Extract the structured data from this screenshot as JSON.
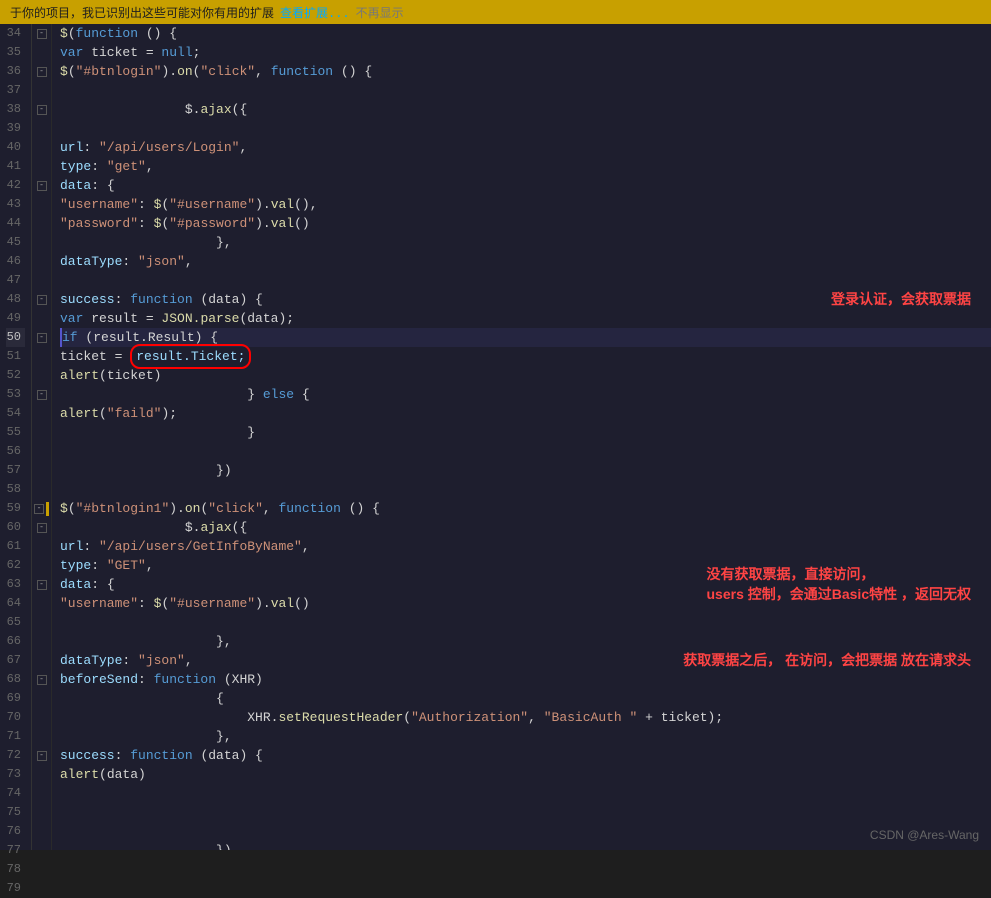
{
  "banner": {
    "text": "于你的项目，我已识别出这些可能对你有用的扩展",
    "link_text": "查看扩展...",
    "dismiss_text": "不再显示"
  },
  "watermark": "CSDN @Ares-Wang",
  "lines": [
    {
      "num": 34,
      "indent": 2,
      "has_fold": true,
      "content": "$(function () {",
      "fold": "open"
    },
    {
      "num": 35,
      "indent": 3,
      "content": "var ticket = null;"
    },
    {
      "num": 36,
      "indent": 3,
      "has_fold": true,
      "content": "$(\"#btnlogin\").on(\"click\", function () {",
      "fold": "open"
    },
    {
      "num": 37,
      "indent": 0,
      "content": ""
    },
    {
      "num": 38,
      "indent": 4,
      "has_fold": true,
      "content": "$.ajax({",
      "fold": "open"
    },
    {
      "num": 39,
      "indent": 0,
      "content": ""
    },
    {
      "num": 40,
      "indent": 5,
      "content": "url: \"/api/users/Login\","
    },
    {
      "num": 41,
      "indent": 5,
      "content": "type: \"get\","
    },
    {
      "num": 42,
      "indent": 5,
      "has_fold": true,
      "content": "data: {",
      "fold": "open"
    },
    {
      "num": 43,
      "indent": 6,
      "content": "\"username\": $(\"#username\").val(),"
    },
    {
      "num": 44,
      "indent": 6,
      "content": "\"password\": $(\"#password\").val()"
    },
    {
      "num": 45,
      "indent": 5,
      "content": "},"
    },
    {
      "num": 46,
      "indent": 5,
      "content": "dataType: \"json\","
    },
    {
      "num": 47,
      "indent": 0,
      "content": ""
    },
    {
      "num": 48,
      "indent": 5,
      "has_fold": true,
      "content": "success: function (data) {",
      "fold": "open"
    },
    {
      "num": 49,
      "indent": 6,
      "content": "var result = JSON.parse(data);"
    },
    {
      "num": 50,
      "indent": 6,
      "has_fold": true,
      "content": "if (result.Result) {",
      "fold": "open",
      "is_current": true
    },
    {
      "num": 51,
      "indent": 7,
      "content": "ticket = result.Ticket;",
      "has_ticket_highlight": true
    },
    {
      "num": 52,
      "indent": 7,
      "content": "alert(ticket)"
    },
    {
      "num": 53,
      "indent": 6,
      "has_fold": true,
      "content": "} else {",
      "fold": "open"
    },
    {
      "num": 54,
      "indent": 7,
      "content": "alert(\"faild\");"
    },
    {
      "num": 55,
      "indent": 6,
      "content": "}"
    },
    {
      "num": 56,
      "indent": 0,
      "content": ""
    },
    {
      "num": 57,
      "indent": 5,
      "content": "})"
    },
    {
      "num": 58,
      "indent": 0,
      "content": ""
    },
    {
      "num": 59,
      "indent": 3,
      "has_fold": true,
      "content": "$(\"#btnlogin1\").on(\"click\", function () {",
      "fold": "open"
    },
    {
      "num": 60,
      "indent": 4,
      "has_fold": true,
      "content": "$.ajax({",
      "fold": "open"
    },
    {
      "num": 61,
      "indent": 5,
      "content": "url: \"/api/users/GetInfoByName\","
    },
    {
      "num": 62,
      "indent": 5,
      "content": "type: \"GET\","
    },
    {
      "num": 63,
      "indent": 5,
      "has_fold": true,
      "content": "data: {",
      "fold": "open"
    },
    {
      "num": 64,
      "indent": 6,
      "content": "\"username\": $(\"#username\").val()"
    },
    {
      "num": 65,
      "indent": 0,
      "content": ""
    },
    {
      "num": 66,
      "indent": 5,
      "content": "},"
    },
    {
      "num": 67,
      "indent": 5,
      "content": "dataType: \"json\","
    },
    {
      "num": 68,
      "indent": 5,
      "has_fold": true,
      "content": "beforeSend: function (XHR)",
      "fold": "open"
    },
    {
      "num": 69,
      "indent": 5,
      "content": "{"
    },
    {
      "num": 70,
      "indent": 6,
      "content": "XHR.setRequestHeader(\"Authorization\", \"BasicAuth \" + ticket);"
    },
    {
      "num": 71,
      "indent": 5,
      "content": "},"
    },
    {
      "num": 72,
      "indent": 5,
      "has_fold": true,
      "content": "success: function (data) {",
      "fold": "open"
    },
    {
      "num": 73,
      "indent": 6,
      "content": "alert(data)"
    },
    {
      "num": 74,
      "indent": 0,
      "content": ""
    },
    {
      "num": 75,
      "indent": 0,
      "content": ""
    },
    {
      "num": 76,
      "indent": 0,
      "content": ""
    },
    {
      "num": 77,
      "indent": 5,
      "content": "})"
    },
    {
      "num": 78,
      "indent": 4,
      "content": "})"
    },
    {
      "num": 79,
      "indent": 3,
      "content": "})"
    }
  ],
  "annotations": {
    "line48_text": "登录认证，会获取票据",
    "line63_text1": "没有获取票据，直接访问，",
    "line63_text2": "users 控制，会通过Basic特性 ，返回无权",
    "line67_text": "获取票据之后，  在访问，会把票据  放在请求头"
  }
}
